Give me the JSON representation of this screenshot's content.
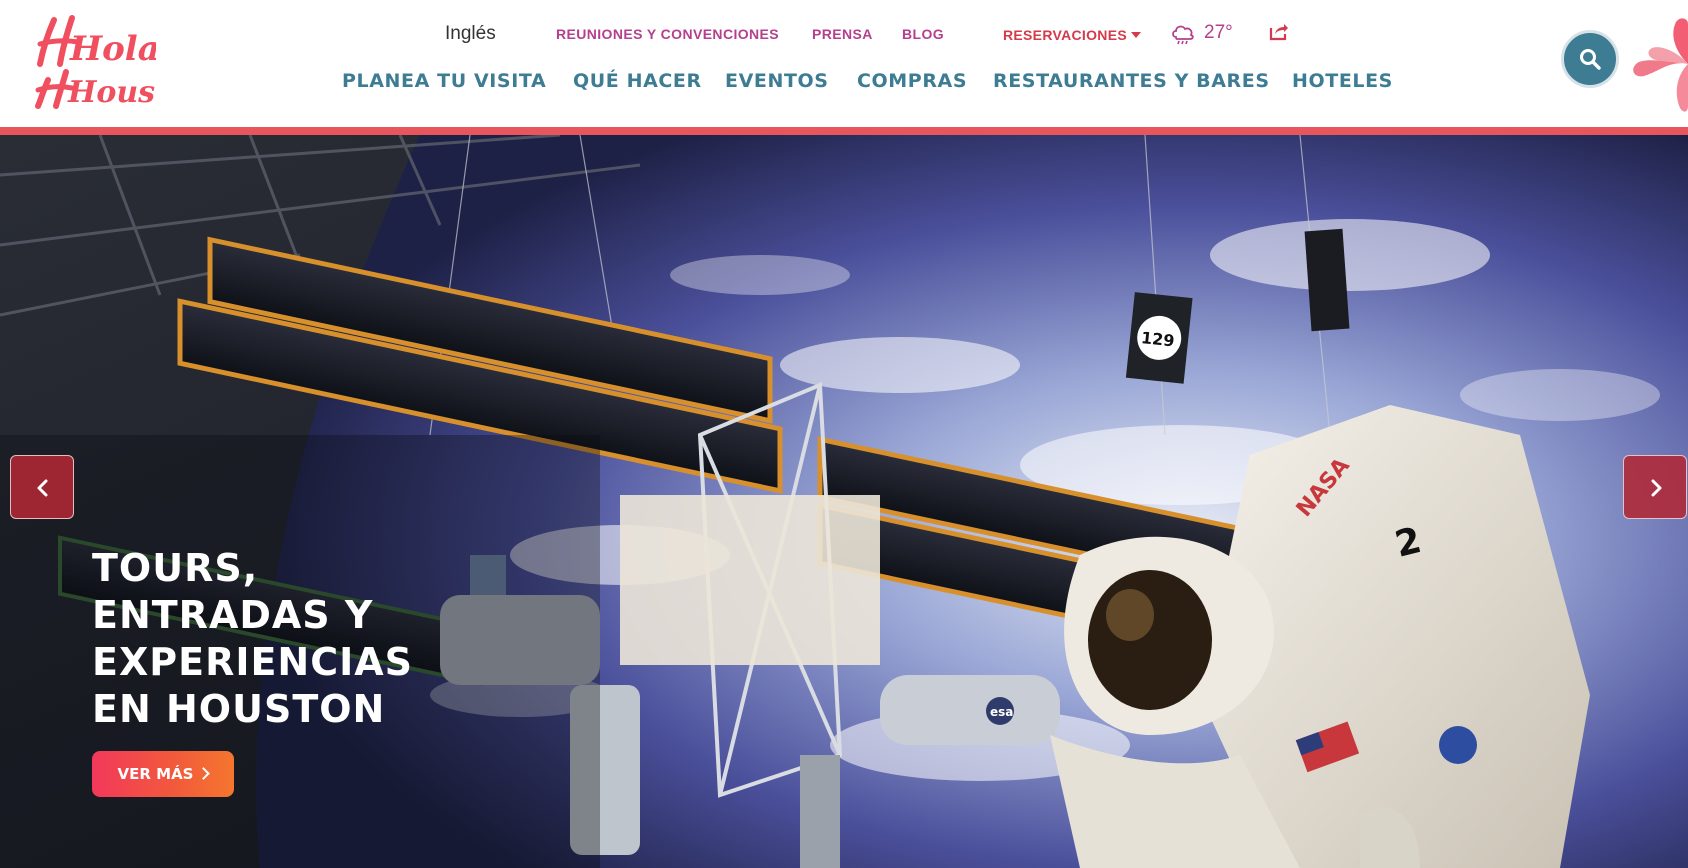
{
  "brand": {
    "logo_text_line1": "Hola",
    "logo_text_line2": "Houston",
    "logo_color": "#ef4f5e"
  },
  "utility_nav": {
    "language": "Inglés",
    "links": [
      "REUNIONES Y CONVENCIONES",
      "PRENSA",
      "BLOG"
    ],
    "reservations_label": "RESERVACIONES",
    "weather": {
      "icon": "rain-cloud-icon",
      "temperature": "27°"
    },
    "share_icon": "share-icon"
  },
  "main_nav": {
    "items": [
      "PLANEA TU VISITA",
      "QUÉ HACER",
      "EVENTOS",
      "COMPRAS",
      "RESTAURANTES Y BARES",
      "HOTELES"
    ]
  },
  "search": {
    "icon": "search-icon"
  },
  "hero": {
    "title_lines": [
      "TOURS,",
      "ENTRADAS Y",
      "EXPERIENCIAS",
      "EN HOUSTON"
    ],
    "cta_label": "VER MÁS",
    "prev_icon": "chevron-left-icon",
    "next_icon": "chevron-right-icon",
    "image_sign_number": "129",
    "image_logo_text": "NASA",
    "image_suit_number": "2",
    "image_module_text": "esa"
  },
  "colors": {
    "accent_red": "#e9555d",
    "nav_teal": "#3d7c93",
    "utility_magenta": "#b53f8c",
    "reservations_red": "#d63a4a",
    "cta_gradient_start": "#f2385b",
    "cta_gradient_end": "#f5762f"
  }
}
